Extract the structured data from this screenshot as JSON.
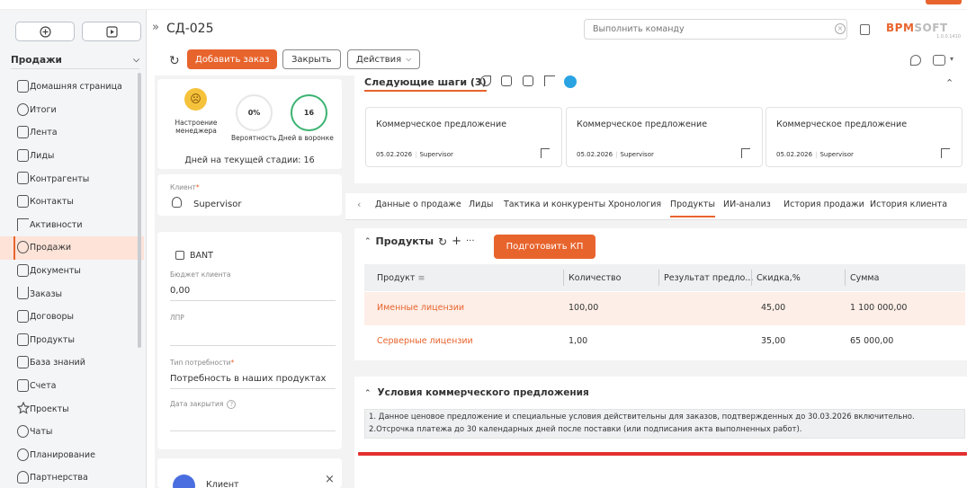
{
  "header": {
    "record_title": "СД-025",
    "command_placeholder": "Выполнить команду",
    "logo_main": "BPM",
    "logo_soft": "SOFT",
    "version": "1.0.0.1410"
  },
  "sidebar": {
    "section": "Продажи",
    "items": [
      {
        "label": "Домашняя страница"
      },
      {
        "label": "Итоги"
      },
      {
        "label": "Лента"
      },
      {
        "label": "Лиды"
      },
      {
        "label": "Контрагенты"
      },
      {
        "label": "Контакты"
      },
      {
        "label": "Активности"
      },
      {
        "label": "Продажи"
      },
      {
        "label": "Документы"
      },
      {
        "label": "Заказы"
      },
      {
        "label": "Договоры"
      },
      {
        "label": "Продукты"
      },
      {
        "label": "База знаний"
      },
      {
        "label": "Счета"
      },
      {
        "label": "Проекты"
      },
      {
        "label": "Чаты"
      },
      {
        "label": "Планирование"
      },
      {
        "label": "Партнерства"
      }
    ],
    "active_index": 7
  },
  "toolbar": {
    "add_order": "Добавить заказ",
    "close": "Закрыть",
    "actions": "Действия"
  },
  "metrics": {
    "mood_label": "Настроение менеджера",
    "probability": "0%",
    "probability_label": "Вероятность",
    "days_in_funnel": "16",
    "days_label": "Дней в воронке",
    "stage_days": "Дней на текущей стадии: 16"
  },
  "client": {
    "label": "Клиент",
    "value": "Supervisor"
  },
  "bant": {
    "title": "BANT",
    "budget_label": "Бюджет клиента",
    "budget_value": "0,00",
    "lpr_label": "ЛПР",
    "need_label": "Тип потребности",
    "need_value": "Потребность в наших продуктах",
    "close_date_label": "Дата закрытия"
  },
  "bottom_card": {
    "label": "Клиент"
  },
  "next_steps": {
    "title": "Следующие шаги (3)",
    "cards": [
      {
        "title": "Коммерческое предложение",
        "date": "05.02.2026",
        "owner": "Supervisor"
      },
      {
        "title": "Коммерческое предложение",
        "date": "05.02.2026",
        "owner": "Supervisor"
      },
      {
        "title": "Коммерческое предложение",
        "date": "05.02.2026",
        "owner": "Supervisor"
      }
    ]
  },
  "tabs": [
    {
      "label": "Данные о продаже"
    },
    {
      "label": "Лиды"
    },
    {
      "label": "Тактика и конкуренты"
    },
    {
      "label": "Хронология"
    },
    {
      "label": "Продукты"
    },
    {
      "label": "ИИ-анализ"
    },
    {
      "label": "История продажи"
    },
    {
      "label": "История клиента"
    }
  ],
  "active_tab_index": 4,
  "products": {
    "title": "Продукты",
    "prepare_btn": "Подготовить КП",
    "columns": [
      "Продукт",
      "Количество",
      "Результат предло...",
      "Скидка,%",
      "Сумма"
    ],
    "rows": [
      {
        "product": "Именные лицензии",
        "qty": "100,00",
        "result": "",
        "discount": "45,00",
        "sum": "1 100 000,00"
      },
      {
        "product": "Серверные лицензии",
        "qty": "1,00",
        "result": "",
        "discount": "35,00",
        "sum": "65 000,00"
      }
    ]
  },
  "conditions": {
    "title": "Условия коммерческого предложения",
    "lines": [
      "1. Данное ценовое предложение и специальные условия действительны для заказов, подтвержденных до 30.03.2026 включительно.",
      "2.Отсрочка платежа до 30 календарных дней после поставки (или подписания акта выполненных работ)."
    ]
  },
  "colors": {
    "accent": "#e8642d",
    "error_line": "#e32f2f",
    "positive_ring": "#3cb371"
  }
}
